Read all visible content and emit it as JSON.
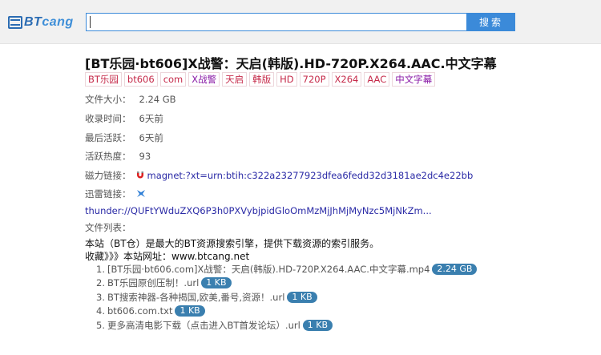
{
  "header": {
    "logo": {
      "prefix": "BT",
      "suffix": "cang"
    },
    "search": {
      "value": "",
      "button": "搜索"
    }
  },
  "title": "[BT乐园·bt606]X战警：天启(韩版).HD-720P.X264.AAC.中文字幕",
  "tags": [
    {
      "text": "BT乐园",
      "highlight": false
    },
    {
      "text": "bt606",
      "highlight": false
    },
    {
      "text": "com",
      "highlight": false
    },
    {
      "text": "X战警",
      "highlight": true
    },
    {
      "text": "天启",
      "highlight": false
    },
    {
      "text": "韩版",
      "highlight": false
    },
    {
      "text": "HD",
      "highlight": false
    },
    {
      "text": "720P",
      "highlight": false
    },
    {
      "text": "X264",
      "highlight": false
    },
    {
      "text": "AAC",
      "highlight": false
    },
    {
      "text": "中文字幕",
      "highlight": true
    }
  ],
  "info": {
    "size": {
      "label": "文件大小：",
      "value": "2.24 GB"
    },
    "indexed": {
      "label": "收录时间：",
      "value": "6天前"
    },
    "last_active": {
      "label": "最后活跃：",
      "value": "6天前"
    },
    "heat": {
      "label": "活跃热度：",
      "value": "93"
    },
    "magnet": {
      "label": "磁力链接：",
      "value": "magnet:?xt=urn:btih:c322a23277923dfea6fedd32d3181ae2dc4e22bb"
    },
    "thunder": {
      "label": "迅雷链接：",
      "value": "thunder://QUFtYWduZXQ6P3h0PXVybjpidGloOmMzMjJhMjMyNzc5MjNkZm..."
    },
    "file_list_label": "文件列表："
  },
  "description": {
    "line1": "本站（BT仓）是最大的BT资源搜索引擎，提供下载资源的索引服务。",
    "line2": "收藏》》》本站网址：www.btcang.net"
  },
  "files": [
    {
      "num": "1.",
      "name": "[BT乐园·bt606.com]X战警：天启(韩版).HD-720P.X264.AAC.中文字幕.mp4",
      "size": "2.24 GB"
    },
    {
      "num": "2.",
      "name": "BT乐园原创压制！.url",
      "size": "1 KB"
    },
    {
      "num": "3.",
      "name": "BT搜索神器-各种揭国,欧美,番号,资源！.url",
      "size": "1 KB"
    },
    {
      "num": "4.",
      "name": "bt606.com.txt",
      "size": "1 KB"
    },
    {
      "num": "5.",
      "name": "更多高清电影下载（点击进入BT首发论坛）.url",
      "size": "1 KB"
    }
  ]
}
